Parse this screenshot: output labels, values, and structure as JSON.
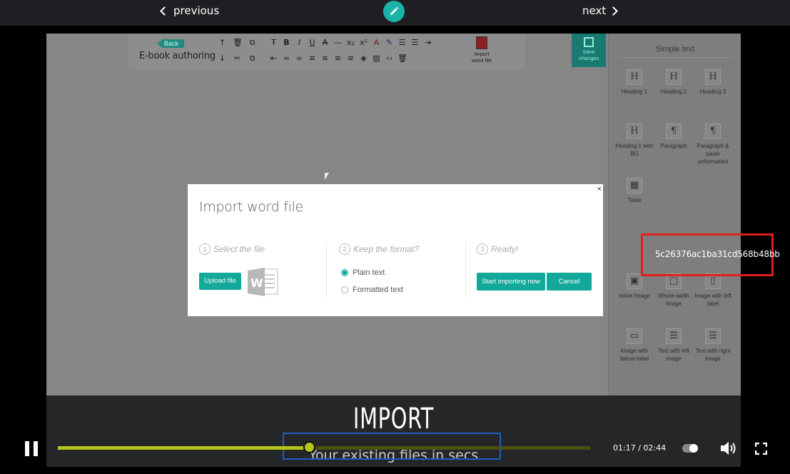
{
  "nav": {
    "previous_label": "previous",
    "next_label": "next"
  },
  "toolbar": {
    "back_label": "Back",
    "title": "E-book authoring",
    "import_label_1": "Import",
    "import_label_2": "word file",
    "save_label_1": "Save",
    "save_label_2": "changes"
  },
  "sidebar": {
    "title": "Simple text",
    "tiles": [
      {
        "label": "Heading 1",
        "glyph": "H"
      },
      {
        "label": "Heading 2",
        "glyph": "H"
      },
      {
        "label": "Heading 3",
        "glyph": "H"
      },
      {
        "label": "Heading 1 with BG",
        "glyph": "H"
      },
      {
        "label": "Paragraph",
        "glyph": "¶"
      },
      {
        "label": "Paragraph & paste unformatted",
        "glyph": "¶"
      },
      {
        "label": "Table",
        "glyph": "▦"
      },
      {
        "label": "Inline Image",
        "glyph": "▣"
      },
      {
        "label": "Whole-width Image",
        "glyph": "□"
      },
      {
        "label": "Image with left label",
        "glyph": "▯"
      },
      {
        "label": "Image with below label",
        "glyph": "▭"
      },
      {
        "label": "Text with left image",
        "glyph": "☰"
      },
      {
        "label": "Text with right image",
        "glyph": "☰"
      }
    ]
  },
  "dialog": {
    "title": "Import word file",
    "close": "×",
    "steps": [
      {
        "num": "1",
        "label": "Select the file"
      },
      {
        "num": "2",
        "label": "Keep the format?"
      },
      {
        "num": "3",
        "label": "Ready!"
      }
    ],
    "upload_label": "Upload file",
    "options": [
      "Plain text",
      "Formatted text"
    ],
    "selected_option": "Plain text",
    "start_label": "Start importing now",
    "cancel_label": "Cancel"
  },
  "overlay_id": "5c26376ac1ba31cd568b48bb",
  "caption": {
    "title": "IMPORT",
    "subtitle": "Your existing files in secs"
  },
  "player": {
    "time": "01:17 / 02:44",
    "progress": 0.472,
    "accent": "#b3c619"
  }
}
